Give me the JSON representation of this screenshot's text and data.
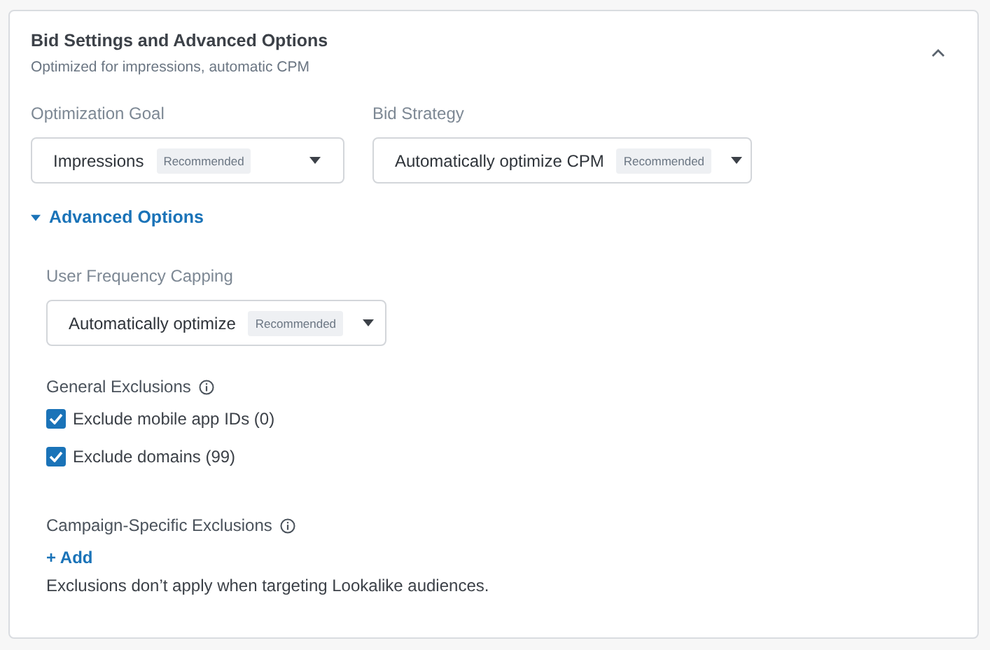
{
  "card": {
    "title": "Bid Settings and Advanced Options",
    "subtitle": "Optimized for impressions, automatic CPM",
    "expanded": true
  },
  "fields": [
    {
      "label": "Optimization Goal",
      "value": "Impressions",
      "badge": "Recommended"
    },
    {
      "label": "Bid Strategy",
      "value": "Automatically optimize CPM",
      "badge": "Recommended"
    }
  ],
  "advanced": {
    "label": "Advanced Options",
    "expanded": true,
    "frequency": {
      "label": "User Frequency Capping",
      "value": "Automatically optimize",
      "badge": "Recommended"
    },
    "general_exclusions": {
      "label": "General Exclusions",
      "options": [
        {
          "label": "Exclude mobile app IDs (0)",
          "checked": true
        },
        {
          "label": "Exclude domains (99)",
          "checked": true
        }
      ]
    },
    "campaign_exclusions": {
      "label": "Campaign-Specific Exclusions",
      "add": "+ Add",
      "note": "Exclusions don’t apply when targeting Lookalike audiences."
    }
  }
}
